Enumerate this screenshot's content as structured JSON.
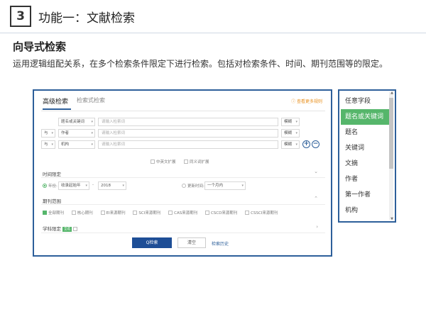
{
  "slide": {
    "number": "3",
    "title": "功能一：文献检索",
    "subtitle": "向导式检索",
    "description": "运用逻辑组配关系，在多个检索条件限定下进行检索。包括对检索条件、时间、期刊范围等的限定。"
  },
  "panel": {
    "tab_active": "高级检索",
    "tab_other": "检索式检索",
    "more_link": "ⓘ 查看更多规则",
    "rows": [
      {
        "logic": "",
        "field": "题名或关键词",
        "placeholder": "请输入检索词",
        "match": "模糊"
      },
      {
        "logic": "与",
        "field": "作者",
        "placeholder": "请输入检索词",
        "match": "模糊"
      },
      {
        "logic": "与",
        "field": "机构",
        "placeholder": "请输入检索词",
        "match": "模糊"
      }
    ],
    "expand": {
      "cn": "中英文扩展",
      "syn": "同义词扩展"
    },
    "time": {
      "label": "时间限定",
      "year_label": "年份:",
      "from": "收录起始年",
      "dash": "-",
      "to": "2018",
      "update_label": "更新时间:",
      "update_value": "一个月内"
    },
    "journal": {
      "label": "期刊范围",
      "options": [
        "全部期刊",
        "核心期刊",
        "EI来源期刊",
        "SCI来源期刊",
        "CAS来源期刊",
        "CSCD来源期刊",
        "CSSCI来源期刊"
      ]
    },
    "subject": {
      "label": "学科限定",
      "tag": "全选"
    },
    "buttons": {
      "search": "Q检索",
      "clear": "清空",
      "history": "检索历史"
    }
  },
  "dropdown": {
    "items": [
      "任意字段",
      "题名或关键词",
      "题名",
      "关键词",
      "文摘",
      "作者",
      "第一作者",
      "机构"
    ],
    "selected_index": 1
  },
  "colors": {
    "accent": "#2d5f9a",
    "green": "#56b66b",
    "button": "#1e4e96",
    "orange": "#e8901e"
  }
}
